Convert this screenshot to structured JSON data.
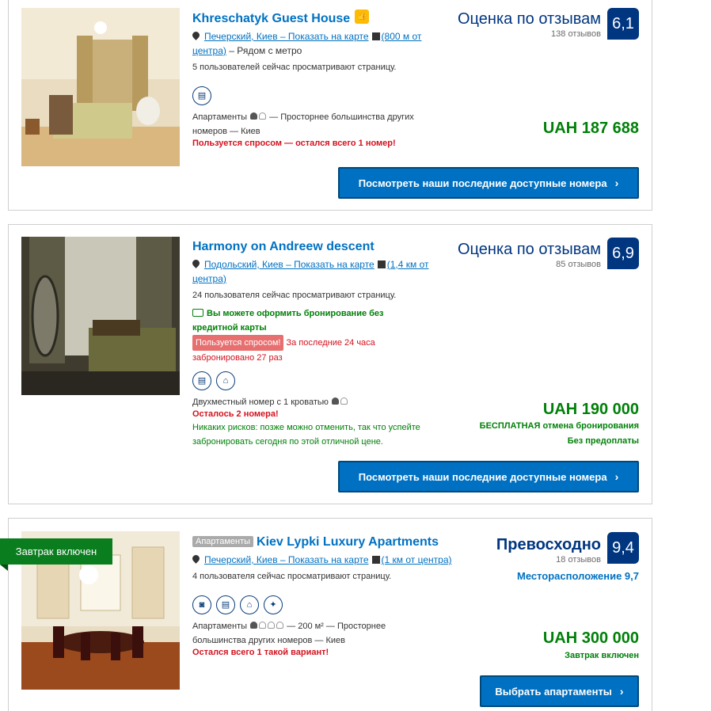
{
  "hotels": [
    {
      "name": "Khreschatyk Guest House",
      "address_link": "Печерский, Киев – Показать на карте",
      "distance": "(800 м от центра)",
      "distance_extra": " – Рядом с метро",
      "viewers": "5 пользователей сейчас просматривают страницу.",
      "room_type": "Апартаменты",
      "room_desc": "— Просторнее большинства других номеров — Киев",
      "scarcity": "Пользуется спросом — остался всего 1 номер!",
      "score_word": "Оценка по отзывам",
      "reviews": "138 отзывов",
      "score": "6,1",
      "price": "UAH 187 688",
      "cta": "Посмотреть наши последние доступные номера"
    },
    {
      "name": "Harmony on Andreew descent",
      "address_link": "Подольский, Киев – Показать на карте",
      "distance": "(1,4 км от центра)",
      "viewers": "24 пользователя сейчас просматривают страницу.",
      "no_card": "Вы можете оформить бронирование без кредитной карты",
      "in_demand": "Пользуется спросом!",
      "booked_recent": "За последние 24 часа забронировано 27 раз",
      "room_type": "Двухместный номер с 1 кроватью",
      "scarcity": "Осталось 2 номера!",
      "no_risk": "Никаких рисков: позже можно отменить, так что успейте забронировать сегодня по этой отличной цене.",
      "score_word": "Оценка по отзывам",
      "reviews": "85 отзывов",
      "score": "6,9",
      "price": "UAH 190 000",
      "free_cancel": "БЕСПЛАТНАЯ отмена бронирования",
      "no_prepay": "Без предоплаты",
      "cta": "Посмотреть наши последние доступные номера"
    },
    {
      "tag": "Апартаменты",
      "name": "Kiev Lypki Luxury Apartments",
      "address_link": "Печерский, Киев – Показать на карте",
      "distance": "(1 км от центра)",
      "viewers": "4 пользователя сейчас просматривают страницу.",
      "room_type": "Апартаменты",
      "room_desc": "— 200 м² — Просторнее большинства других номеров — Киев",
      "scarcity": "Остался всего 1 такой вариант!",
      "score_word": "Превосходно",
      "reviews": "18 отзывов",
      "score": "9,4",
      "location_score": "Месторасположение 9,7",
      "price": "UAH 300 000",
      "breakfast_note": "Завтрак включен",
      "breakfast_ribbon": "Завтрак включен",
      "cta": "Выбрать апартаменты"
    }
  ],
  "colors": {
    "brand_blue": "#003580",
    "link_blue": "#0071c2",
    "green": "#008009",
    "red": "#d4111e"
  }
}
